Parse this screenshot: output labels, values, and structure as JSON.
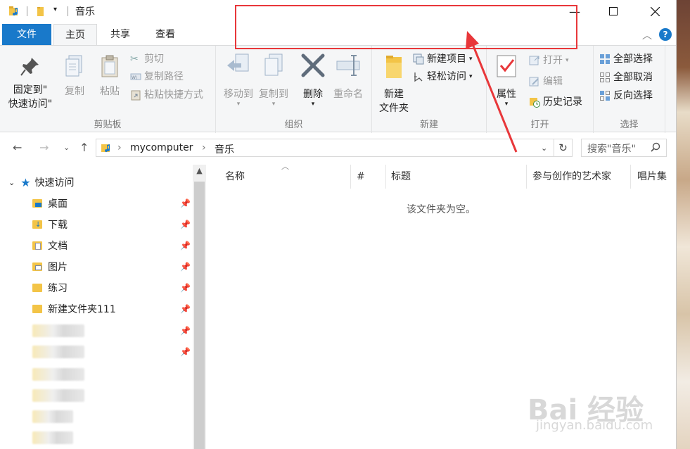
{
  "window": {
    "title": "音乐"
  },
  "tabs": [
    {
      "label": "文件"
    },
    {
      "label": "主页"
    },
    {
      "label": "共享"
    },
    {
      "label": "查看"
    }
  ],
  "ribbon": {
    "clipboard": {
      "label": "剪贴板",
      "pin_quick_line1": "固定到\"",
      "pin_quick_line2": "快速访问\"",
      "copy": "复制",
      "paste": "粘贴",
      "cut": "剪切",
      "copy_path": "复制路径",
      "paste_shortcut": "粘贴快捷方式"
    },
    "organize": {
      "label": "组织",
      "move_to": "移动到",
      "copy_to": "复制到",
      "delete": "删除",
      "rename": "重命名"
    },
    "new": {
      "label": "新建",
      "new_folder_line1": "新建",
      "new_folder_line2": "文件夹",
      "new_item": "新建项目",
      "easy_access": "轻松访问"
    },
    "open": {
      "label": "打开",
      "properties": "属性",
      "open": "打开",
      "edit": "编辑",
      "history": "历史记录"
    },
    "select": {
      "label": "选择",
      "select_all": "全部选择",
      "select_none": "全部取消",
      "invert": "反向选择"
    }
  },
  "address": {
    "segments": [
      "mycomputer",
      "音乐"
    ],
    "search_placeholder": "搜索\"音乐\""
  },
  "nav": {
    "quick_access": "快速访问",
    "items": [
      {
        "label": "桌面"
      },
      {
        "label": "下载"
      },
      {
        "label": "文档"
      },
      {
        "label": "图片"
      },
      {
        "label": "练习"
      },
      {
        "label": "新建文件夹111"
      }
    ]
  },
  "columns": [
    "名称",
    "#",
    "标题",
    "参与创作的艺术家",
    "唱片集"
  ],
  "empty_message": "该文件夹为空。",
  "watermark": {
    "brand": "Bai 经验",
    "url": "jingyan.baidu.com"
  },
  "colors": {
    "accent": "#1979ca",
    "annotation": "#e8373a",
    "folder": "#f3c447"
  }
}
